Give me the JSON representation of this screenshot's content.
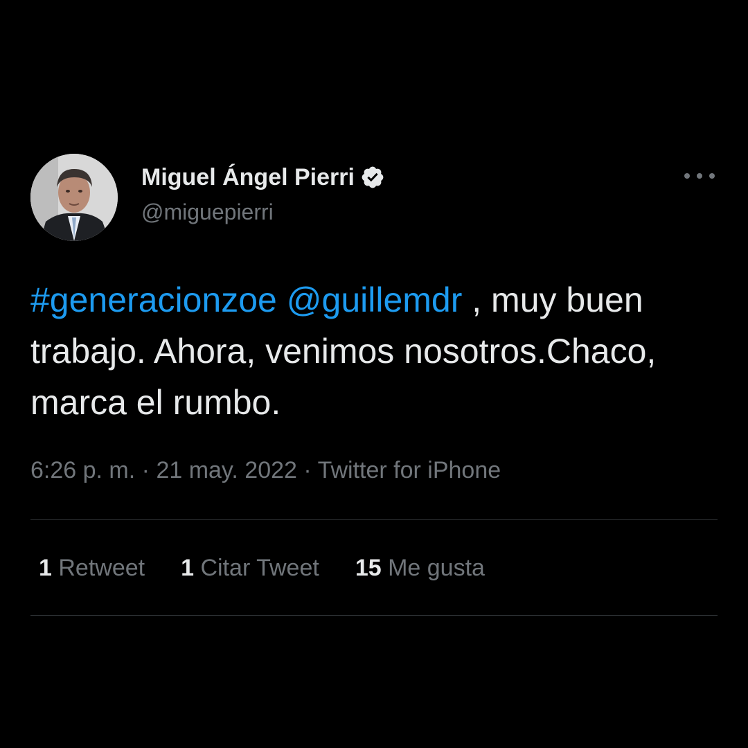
{
  "author": {
    "display_name": "Miguel Ángel Pierri",
    "handle": "@miguepierri",
    "verified": true
  },
  "tweet": {
    "hashtag": "#generacionzoe",
    "mention": "@guillemdr",
    "text_after": " , muy buen trabajo. Ahora, venimos nosotros.Chaco, marca el rumbo."
  },
  "meta": {
    "time": "6:26 p. m.",
    "separator": "·",
    "date": "21 may. 2022",
    "source": "Twitter for iPhone"
  },
  "stats": {
    "retweets_count": "1",
    "retweets_label": "Retweet",
    "quotes_count": "1",
    "quotes_label": "Citar Tweet",
    "likes_count": "15",
    "likes_label": "Me gusta"
  },
  "colors": {
    "background": "#000000",
    "text": "#e7e9ea",
    "secondary_text": "#71767b",
    "link": "#1d9bf0",
    "divider": "#2f3336"
  },
  "icons": {
    "verified": "verified-badge-icon",
    "more": "more-options-icon"
  }
}
